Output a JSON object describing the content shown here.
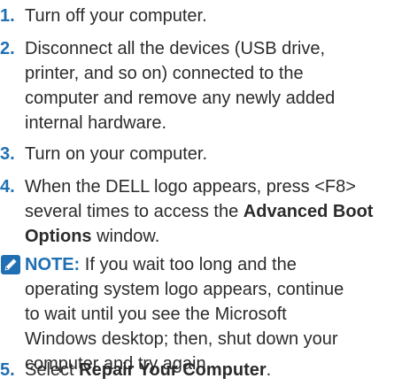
{
  "steps": [
    {
      "number": "1.",
      "lines": [
        "Turn off your computer."
      ]
    },
    {
      "number": "2.",
      "lines": [
        "Disconnect all the devices (USB drive,",
        "printer, and so on) connected to the",
        "computer and remove any newly added",
        "internal hardware."
      ]
    },
    {
      "number": "3.",
      "lines": [
        "Turn on your computer."
      ]
    },
    {
      "number": "4.",
      "line1": "When the DELL logo appears, press <F8>",
      "line2_prefix": "several times to access the ",
      "line2_bold": "Advanced Boot",
      "line3_bold": "Options",
      "line3_suffix": " window."
    },
    {
      "number": "5.",
      "prefix": "Select ",
      "bold": "Repair Your Computer",
      "suffix": "."
    }
  ],
  "note": {
    "icon": "pencil-note-icon",
    "label": "NOTE:",
    "line1": " If you wait too long and the",
    "lines": [
      "operating system logo appears, continue",
      "to wait until you see the Microsoft",
      "Windows desktop; then, shut down your",
      "computer and try again."
    ]
  },
  "colors": {
    "accent": "#1f6fb2",
    "text": "#2b2b2b"
  }
}
